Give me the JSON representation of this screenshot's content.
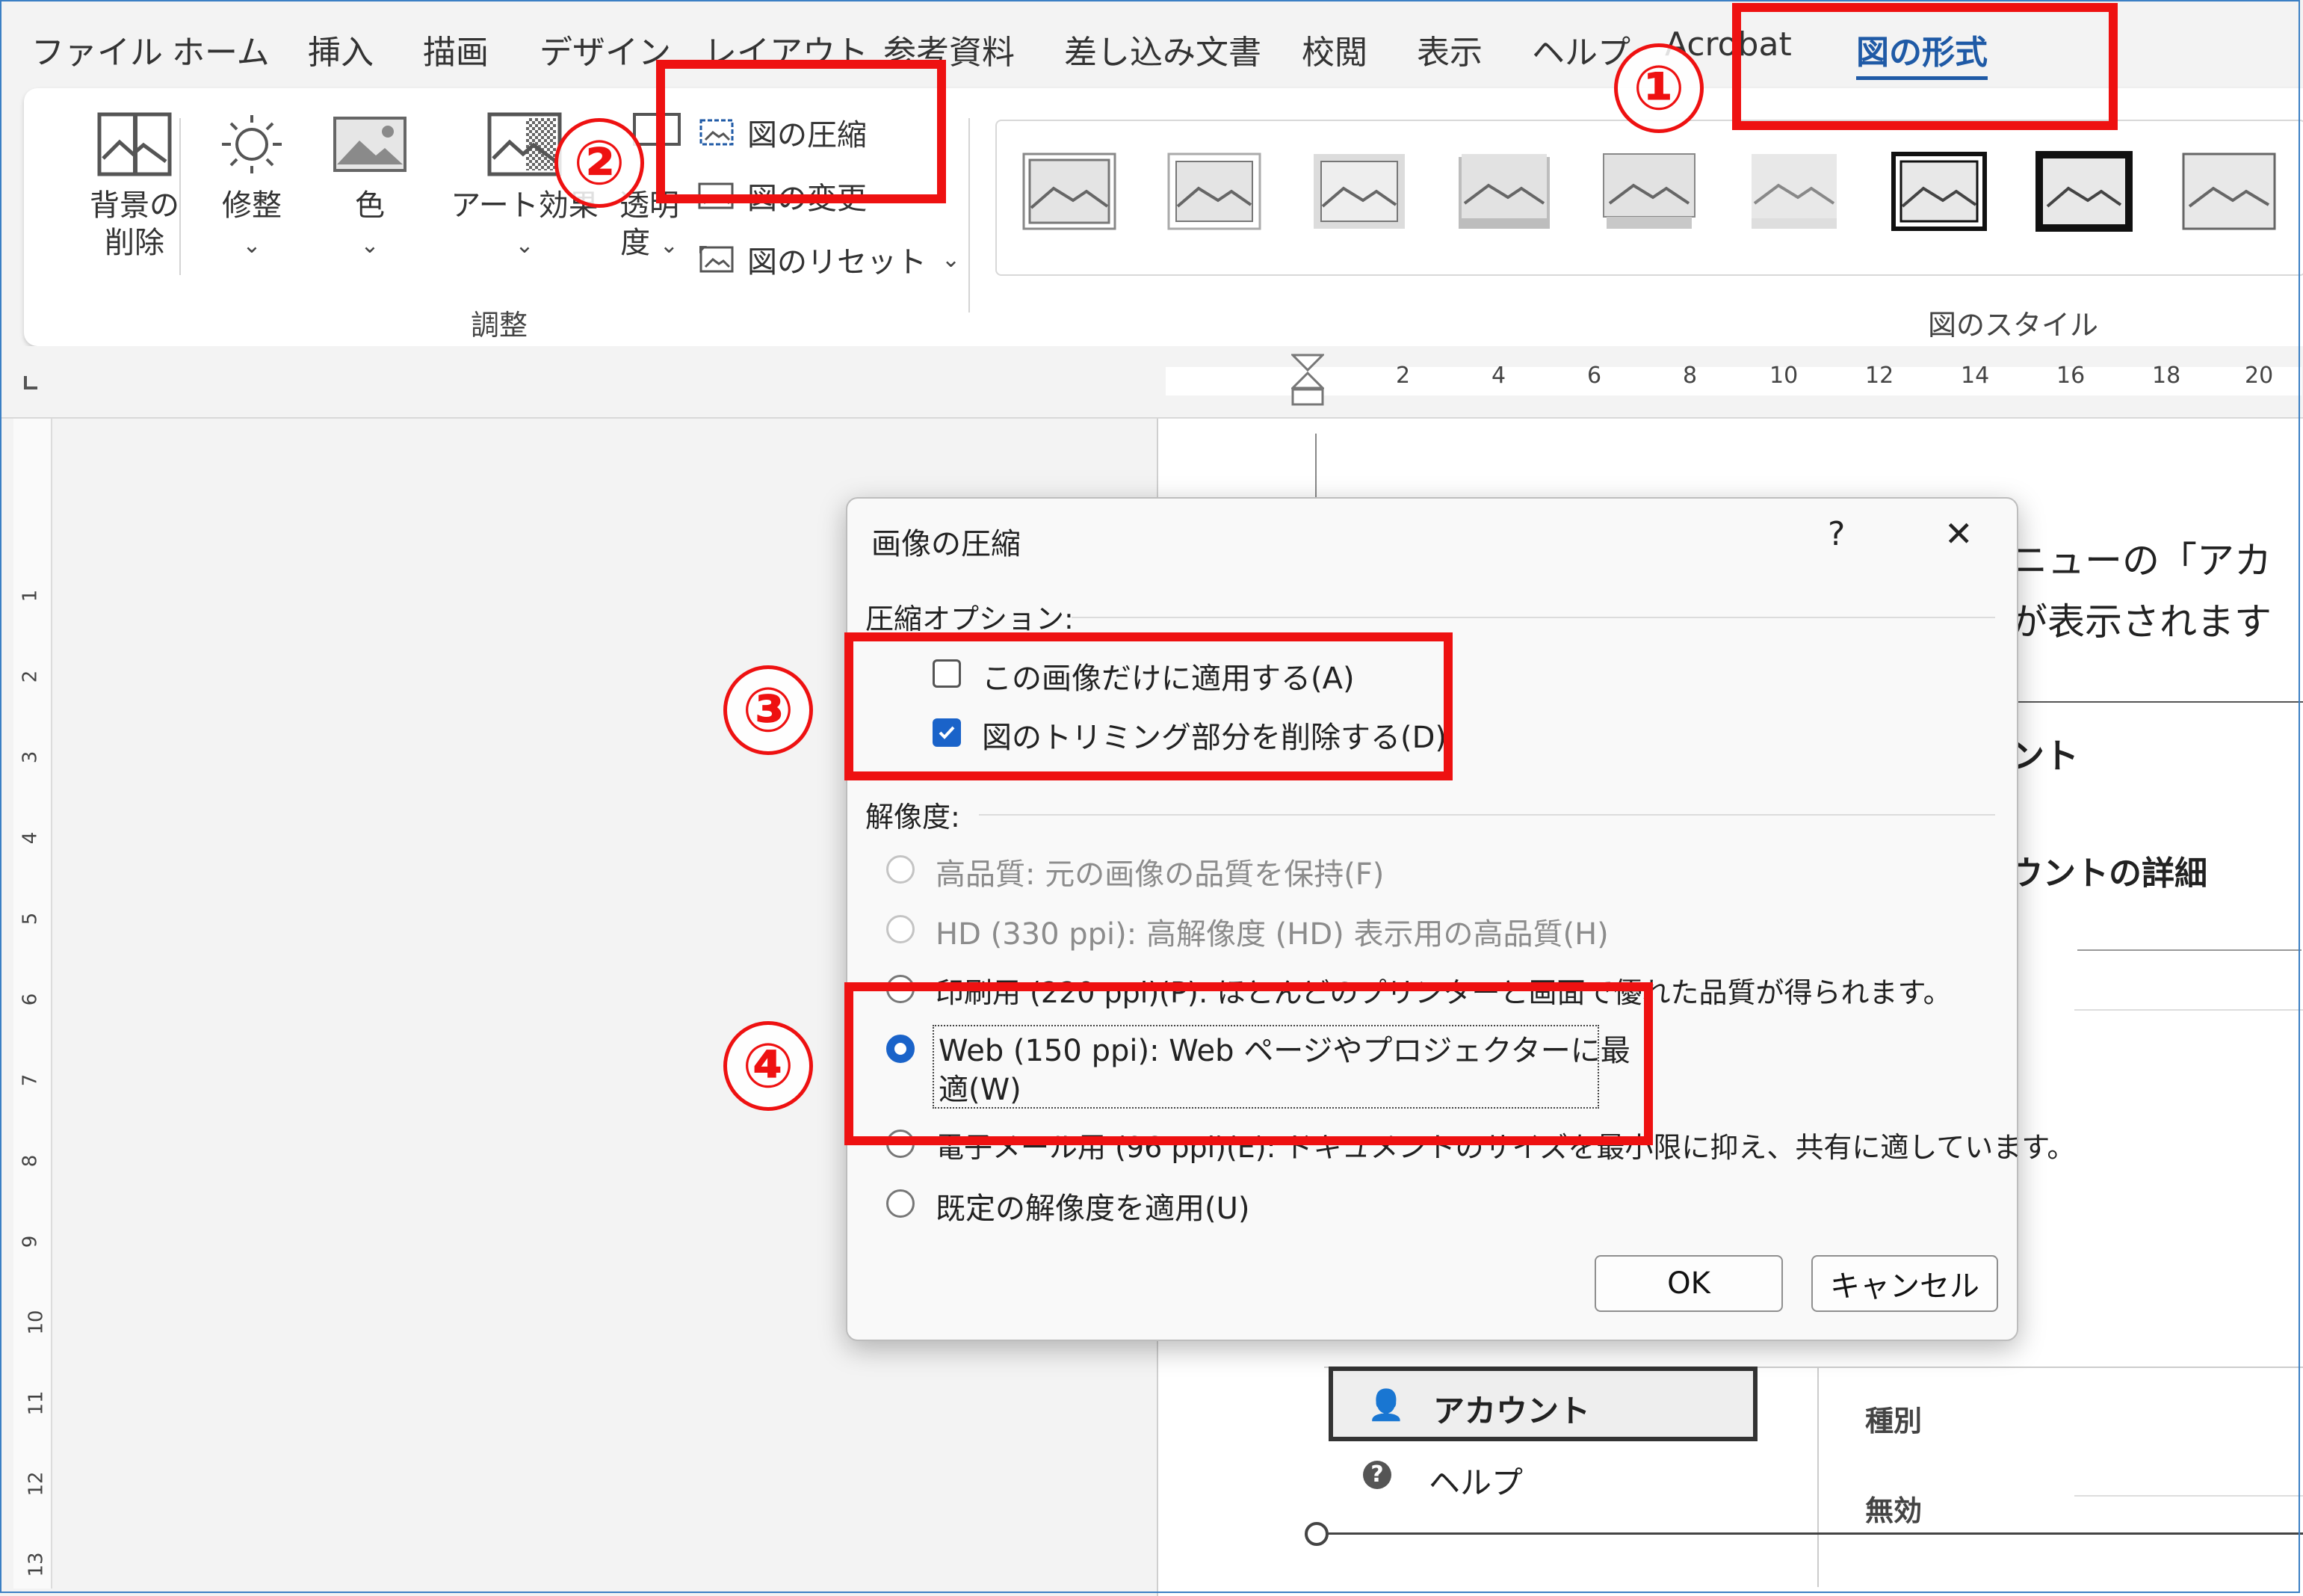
{
  "tabs": [
    {
      "label": "ファイル"
    },
    {
      "label": "ホーム"
    },
    {
      "label": "挿入"
    },
    {
      "label": "描画"
    },
    {
      "label": "デザイン"
    },
    {
      "label": "レイアウト"
    },
    {
      "label": "参考資料"
    },
    {
      "label": "差し込み文書"
    },
    {
      "label": "校閲"
    },
    {
      "label": "表示"
    },
    {
      "label": "ヘルプ"
    },
    {
      "label": "Acrobat"
    },
    {
      "label": "図の形式"
    }
  ],
  "ribbon": {
    "remove_background_line1": "背景の",
    "remove_background_line2": "削除",
    "corrections": "修整",
    "color": "色",
    "artistic_effects": "アート効果",
    "transparency_line1": "透明",
    "transparency_line2": "度",
    "compress": "図の圧縮",
    "change": "図の変更",
    "reset": "図のリセット",
    "group_adjust": "調整",
    "group_styles": "図のスタイル"
  },
  "ruler": {
    "h_ticks": [
      "2",
      "4",
      "6",
      "8",
      "10",
      "12",
      "14",
      "16",
      "18",
      "20"
    ],
    "v_ticks": [
      "1",
      "2",
      "3",
      "4",
      "5",
      "6",
      "7",
      "8",
      "9",
      "10",
      "11",
      "12",
      "13"
    ]
  },
  "document": {
    "line1": "ニューの「アカ",
    "line2": "が表示されます",
    "heading1": "ント",
    "heading2": "ウントの詳細",
    "menu_account": "アカウント",
    "menu_help": "ヘルプ",
    "field_kind": "種別",
    "field_invalid": "無効"
  },
  "dialog": {
    "title": "画像の圧縮",
    "help": "?",
    "close": "✕",
    "compress_options": "圧縮オプション:",
    "apply_only_this": "この画像だけに適用する(A)",
    "delete_cropped": "図のトリミング部分を削除する(D)",
    "resolution": "解像度:",
    "opt_high": "高品質: 元の画像の品質を保持(F)",
    "opt_hd": "HD (330 ppi): 高解像度 (HD) 表示用の高品質(H)",
    "opt_print": "印刷用 (220 ppi)(P): ほとんどのプリンターと画面で優れた品質が得られます。",
    "opt_web_line1": "Web (150 ppi): Web ページやプロジェクターに最",
    "opt_web_line2": "適(W)",
    "opt_email": "電子メール用 (96 ppi)(E): ドキュメントのサイズを最小限に抑え、共有に適しています。",
    "opt_default": "既定の解像度を適用(U)",
    "ok": "OK",
    "cancel": "キャンセル"
  },
  "annotations": {
    "n1": "①",
    "n2": "②",
    "n3": "③",
    "n4": "④"
  },
  "colors": {
    "accent": "#1a63c9",
    "annotation": "#ee1111",
    "active_tab": "#1f5aa6"
  }
}
